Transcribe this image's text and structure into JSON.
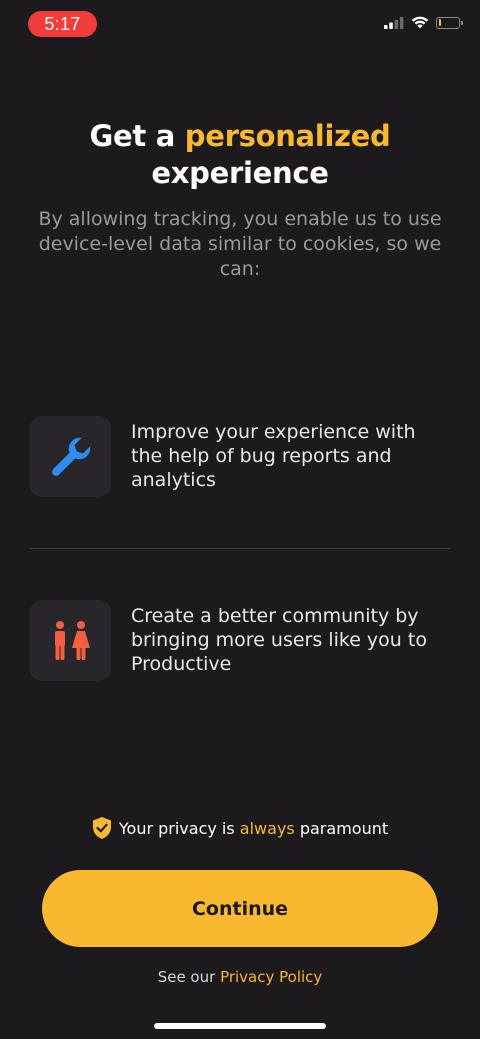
{
  "status_bar": {
    "time": "5:17",
    "battery_level": 0.1,
    "battery_color": "#f7c631"
  },
  "heading": {
    "line1_prefix": "Get a ",
    "line1_accent": "personalized",
    "line2": "experience"
  },
  "subtitle": "By allowing tracking, you enable us to use device-level data similar to cookies, so we can:",
  "features": [
    {
      "icon": "wrench-icon",
      "text": "Improve your experience with the help of bug reports and analytics"
    },
    {
      "icon": "people-icon",
      "text": "Create a better community by bringing more users like you to Productive"
    }
  ],
  "privacy_note": {
    "prefix": "Your privacy is ",
    "accent": "always",
    "suffix": " paramount"
  },
  "continue_button": {
    "label": "Continue"
  },
  "policy": {
    "prefix": "See our ",
    "link": "Privacy Policy"
  },
  "colors": {
    "background": "#1c1a1d",
    "accent": "#f8b830",
    "wrench": "#2f8cf3",
    "people": "#f2603f",
    "time_pill": "#f23b3b"
  }
}
